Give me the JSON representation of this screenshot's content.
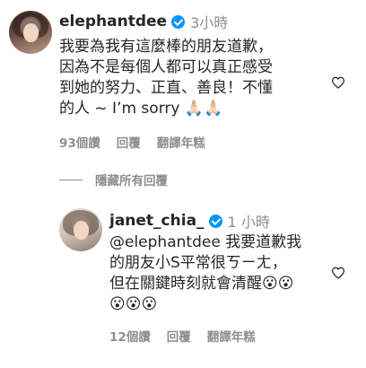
{
  "comments": [
    {
      "username": "elephantdee",
      "time": "3小時",
      "text": "我要為我有這麼棒的朋友道歉，\n因為不是每個人都可以真正感受\n到她的努力、正直、善良！不懂\n的人 ~ I’m sorry 🙏🏻🙏🏻",
      "likes": "93個讚",
      "reply_label": "回覆",
      "translate_label": "翻譯年糕"
    }
  ],
  "hide_replies_label": "隱藏所有回覆",
  "replies": [
    {
      "username": "janet_chia_",
      "time": "1 小時",
      "text": "@elephantdee 我要道歉我\n的朋友小S平常很ㄎㄧㄤ，\n但在關鍵時刻就會清醒😮😮\n😮😮😮",
      "likes": "12個讚",
      "reply_label": "回覆",
      "translate_label": "翻譯年糕"
    }
  ],
  "icons": {
    "like": "heart-outline-icon",
    "verified": "verified-badge-icon"
  },
  "colors": {
    "verified": "#0095f6",
    "secondary_text": "#8e8e8e",
    "primary_text": "#262626"
  }
}
